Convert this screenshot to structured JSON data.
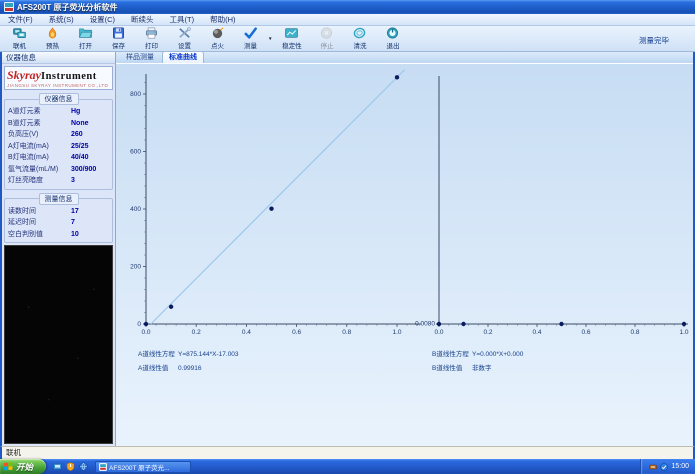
{
  "window": {
    "title": "AFS200T 原子荧光分析软件"
  },
  "menu": {
    "items": [
      {
        "label": "文件(F)",
        "name": "menu-item-file"
      },
      {
        "label": "系统(S)",
        "name": "menu-item-system"
      },
      {
        "label": "设置(C)",
        "name": "menu-item-settings"
      },
      {
        "label": "断续头",
        "name": "menu-item-sampler-head"
      },
      {
        "label": "工具(T)",
        "name": "menu-item-tools"
      },
      {
        "label": "帮助(H)",
        "name": "menu-item-help"
      }
    ]
  },
  "toolbar": {
    "buttons": [
      {
        "label": "联机",
        "name": "toolbar-button-connect",
        "icon": "computer-link-icon",
        "enabled": true
      },
      {
        "label": "预热",
        "name": "toolbar-button-preheat",
        "icon": "preheat-flame-icon",
        "enabled": true
      },
      {
        "label": "打开",
        "name": "toolbar-button-open",
        "icon": "open-folder-icon",
        "enabled": true
      },
      {
        "label": "保存",
        "name": "toolbar-button-save",
        "icon": "save-floppy-icon",
        "enabled": true
      },
      {
        "label": "打印",
        "name": "toolbar-button-print",
        "icon": "printer-icon",
        "enabled": true
      },
      {
        "label": "设置",
        "name": "toolbar-button-settings",
        "icon": "settings-tools-icon",
        "enabled": true
      },
      {
        "label": "点火",
        "name": "toolbar-button-ignite",
        "icon": "ignite-icon",
        "enabled": true
      },
      {
        "label": "测量",
        "name": "toolbar-button-measure",
        "icon": "measure-check-icon",
        "enabled": true,
        "has_dropdown": true
      },
      {
        "label": "稳定性",
        "name": "toolbar-button-stability",
        "icon": "stability-chart-icon",
        "enabled": true,
        "wide": true
      },
      {
        "label": "停止",
        "name": "toolbar-button-stop",
        "icon": "stop-icon",
        "enabled": false
      },
      {
        "label": "清洗",
        "name": "toolbar-button-clean",
        "icon": "clean-swirl-icon",
        "enabled": true
      },
      {
        "label": "退出",
        "name": "toolbar-button-exit",
        "icon": "exit-power-icon",
        "enabled": true
      }
    ],
    "status_text": "测量完毕"
  },
  "left_panel": {
    "header": "仪器信息",
    "logo": {
      "brand_red": "Skyray",
      "brand_black": "Instrument",
      "subtext": "JIANGSU SKYRAY INSTRUMENT CO.,LTD"
    },
    "instrument_group": {
      "caption": "仪器信息",
      "rows": [
        {
          "label": "A道灯元素",
          "value": "Hg"
        },
        {
          "label": "B道灯元素",
          "value": "None"
        },
        {
          "label": "负高压(V)",
          "value": "260"
        },
        {
          "label": "A灯电流(mA)",
          "value": "25/25"
        },
        {
          "label": "B灯电流(mA)",
          "value": "40/40"
        },
        {
          "label": "氩气流量(mL/M)",
          "value": "300/900"
        },
        {
          "label": "灯丝亮暗度",
          "value": "3"
        }
      ]
    },
    "measure_group": {
      "caption": "测量信息",
      "rows": [
        {
          "label": "读数时间",
          "value": "17"
        },
        {
          "label": "延迟时间",
          "value": "7"
        },
        {
          "label": "空白判别值",
          "value": "10"
        }
      ]
    }
  },
  "tabs": [
    {
      "label": "样品测量",
      "name": "tab-sample-measurement",
      "active": false
    },
    {
      "label": "标准曲线",
      "name": "tab-standard-curve",
      "active": true
    }
  ],
  "chart_data": [
    {
      "type": "scatter",
      "name": "A-channel-calibration-curve",
      "x": [
        0.0,
        0.1,
        0.5,
        1.0
      ],
      "y": [
        0,
        60,
        401,
        858
      ],
      "fit": {
        "slope": 875.144,
        "intercept": -17.003
      },
      "xticks": [
        "0.0",
        "0.2",
        "0.4",
        "0.6",
        "0.8",
        "1.0"
      ],
      "yticks": [
        "0",
        "200",
        "400",
        "600",
        "800"
      ],
      "xlim": [
        0,
        1.03
      ],
      "ylim": [
        0,
        880
      ],
      "grid": false,
      "line_color": "#9cc8ec",
      "point_color": "#0a1c5e",
      "equation_label": "A道线性方程",
      "equation": "Y=875.144*X-17.003",
      "linearity_label": "A道线性值",
      "linearity": "0.99916"
    },
    {
      "type": "scatter",
      "name": "B-channel-calibration-curve",
      "x": [
        0.0,
        0.1,
        0.5,
        1.0
      ],
      "y": [
        0,
        0,
        0,
        0
      ],
      "xticks": [
        "0.0",
        "0.2",
        "0.4",
        "0.6",
        "0.8",
        "1.0"
      ],
      "yticks": [],
      "y_axis_label": "0.0080",
      "xlim": [
        0,
        1.0
      ],
      "ylim": [
        0,
        880
      ],
      "grid": false,
      "point_color": "#0a1c5e",
      "equation_label": "B道线性方程",
      "equation": "Y=0.000*X+0.000",
      "linearity_label": "B道线性值",
      "linearity": "非数字"
    }
  ],
  "statusbar": {
    "text": "联机"
  },
  "taskbar": {
    "start_label": "开始",
    "quick_launch": [
      "quick-launch-blue-icon",
      "quick-launch-shield-icon",
      "quick-launch-browser-icon"
    ],
    "task_label": "AFS200T 原子荧光...",
    "tray_icons": [
      "tray-device-icon",
      "tray-status-icon"
    ],
    "time": "15:00"
  },
  "colors": {
    "titlebar_blue": "#1e5cc8",
    "accent_navy": "#0000a6",
    "curve_blue": "#9cc8ec",
    "point_navy": "#0a1c5e",
    "taskbar_blue": "#2158c8",
    "start_green": "#4aa63a"
  }
}
